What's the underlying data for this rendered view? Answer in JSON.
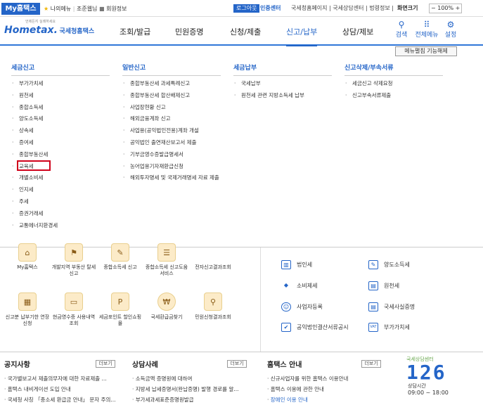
{
  "util": {
    "myhome": "My홈택스",
    "favorites": "나의메뉴",
    "signup": "조준웹님",
    "member": "회원정보",
    "login": "로그아웃",
    "cert": "인증센터",
    "links": "국세청홈페이지 | 국세상담센터 | 법령정보 |",
    "zoom_label": "화면크기",
    "zoom": "100%"
  },
  "header": {
    "logo_small": "언제든지 실례하세요",
    "logo": "Hometax.",
    "logo_sub": "국세청홈택스",
    "nav": [
      "조회/발급",
      "민원증명",
      "신청/제출",
      "신고/납부",
      "상담/제보"
    ],
    "icons": [
      "검색",
      "전체메뉴",
      "설정"
    ]
  },
  "mega": {
    "toggle": "메뉴펼침 기능해제",
    "columns": [
      {
        "title": "세금신고",
        "items": [
          "부가가치세",
          "원천세",
          "종합소득세",
          "양도소득세",
          "상속세",
          "증여세",
          "종합부동산세",
          "교육세",
          "개별소비세",
          "인지세",
          "주세",
          "증권거래세",
          "교통에너지환경세"
        ]
      },
      {
        "title": "일반신고",
        "items": [
          "종합부동산세 과세특례신고",
          "종합부동산세 합산배제신고",
          "사업장현황 신고",
          "해외금융계좌 신고",
          "사업용(공익법인전용)계좌 개설",
          "공익법인 출연재산보고서 제출",
          "기부금영수증발급명세서",
          "농어업용기자재환급신청",
          "해외투자명세 및 국제거래명세 자료 제출"
        ]
      },
      {
        "title": "세금납부",
        "items": [
          "국세납부",
          "원천세 관련 지방소득세 납부"
        ]
      },
      {
        "title": "신고삭제/부속서류",
        "items": [
          "세금신고 삭제요청",
          "신고부속서류제출"
        ]
      }
    ]
  },
  "quick": {
    "row1": [
      "My홈택스",
      "개발지역 부동산 탈세신고",
      "종합소득세 신고",
      "종합소득세 신고도움 서비스",
      "전자신고결과조회"
    ],
    "row2": [
      "신고분 납부기한 연장 신청",
      "현금영수증 사용내역조회",
      "세금포인트 할인쇼핑몰",
      "국세환급금찾기",
      "민원신청결과조회"
    ]
  },
  "right_links": [
    [
      "법인세",
      "양도소득세"
    ],
    [
      "소비제세",
      "원천세"
    ],
    [
      "사업자등록",
      "국세사실증명"
    ],
    [
      "공익법인결산서류공시",
      "부가가치세"
    ]
  ],
  "bottom": {
    "notice_title": "공지사항",
    "notice": [
      "국가별보고서 제출의무자에 대한 자료제출 ...",
      "홈택스 내비게이션 도입 안내",
      "국세청 사칭 「종소세 환급금 안내」 문자 주의..."
    ],
    "case_title": "상담사례",
    "cases": [
      "소득금액 증명원에 대하여",
      "지방세 납세증명서(완납증명) 발행 경로를 알...",
      "부가세과세표준증명원발급"
    ],
    "guide_title": "홈택스 안내",
    "guide": [
      "신규사업자를 위한 홈택스 이용안내",
      "홈택스 이용에 관한 안내",
      "장애인 이용 안내"
    ],
    "more": "더보기",
    "center_title": "국세상담센터",
    "center_num": "126",
    "hours_label": "상담시간",
    "hours": "09:00 ~ 18:00"
  },
  "colors": {
    "brand": "#2465c8",
    "highlight": "#d0021b",
    "icon_bg": "#fcebc8"
  }
}
